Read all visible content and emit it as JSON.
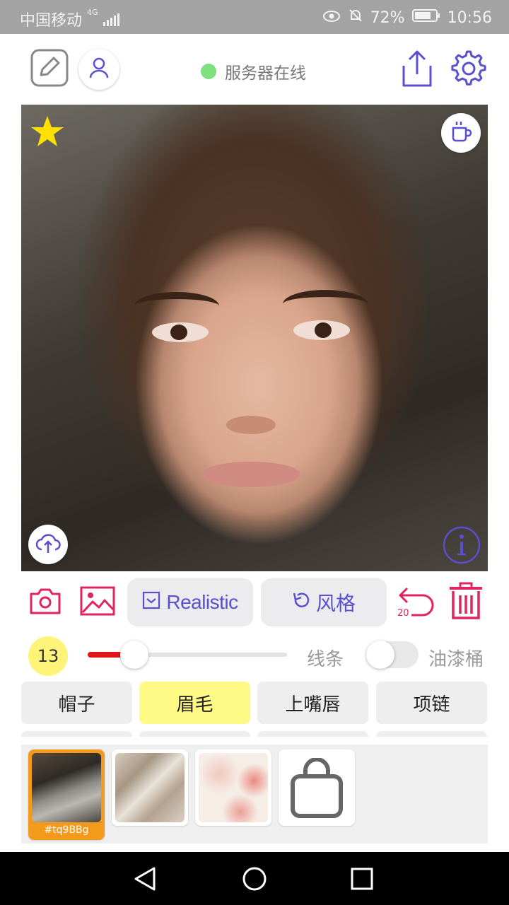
{
  "status_bar": {
    "carrier": "中国移动",
    "network": "4G",
    "battery": "72%",
    "time": "10:56"
  },
  "header": {
    "server_status": "服务器在线",
    "server_status_color": "#7ee07e"
  },
  "toolbar": {
    "mode_label": "Realistic",
    "style_label": "风格",
    "undo_count": "20",
    "accent_color": "#5a4fcf",
    "danger_color": "#e0245e"
  },
  "brush": {
    "size": "13",
    "size_fraction": 0.2,
    "line_label": "线条",
    "bucket_label": "油漆桶",
    "bucket_enabled": false
  },
  "categories": [
    {
      "label": "帽子",
      "selected": false
    },
    {
      "label": "眉毛",
      "selected": true
    },
    {
      "label": "上嘴唇",
      "selected": false
    },
    {
      "label": "项链",
      "selected": false
    }
  ],
  "textures": [
    {
      "caption": "#tq9BBg",
      "selected": true
    },
    {
      "caption": "",
      "selected": false
    },
    {
      "caption": "",
      "selected": false
    }
  ],
  "icons": {
    "edit": "edit-square-icon",
    "user": "user-icon",
    "share": "share-icon",
    "settings": "gear-icon",
    "favorite": "star-icon",
    "coffee": "coffee-cup-icon",
    "upload": "cloud-upload-icon",
    "info": "info-icon",
    "camera": "camera-icon",
    "gallery": "image-icon",
    "undo": "undo-icon",
    "delete": "trash-icon",
    "shop": "shopping-bag-icon"
  }
}
